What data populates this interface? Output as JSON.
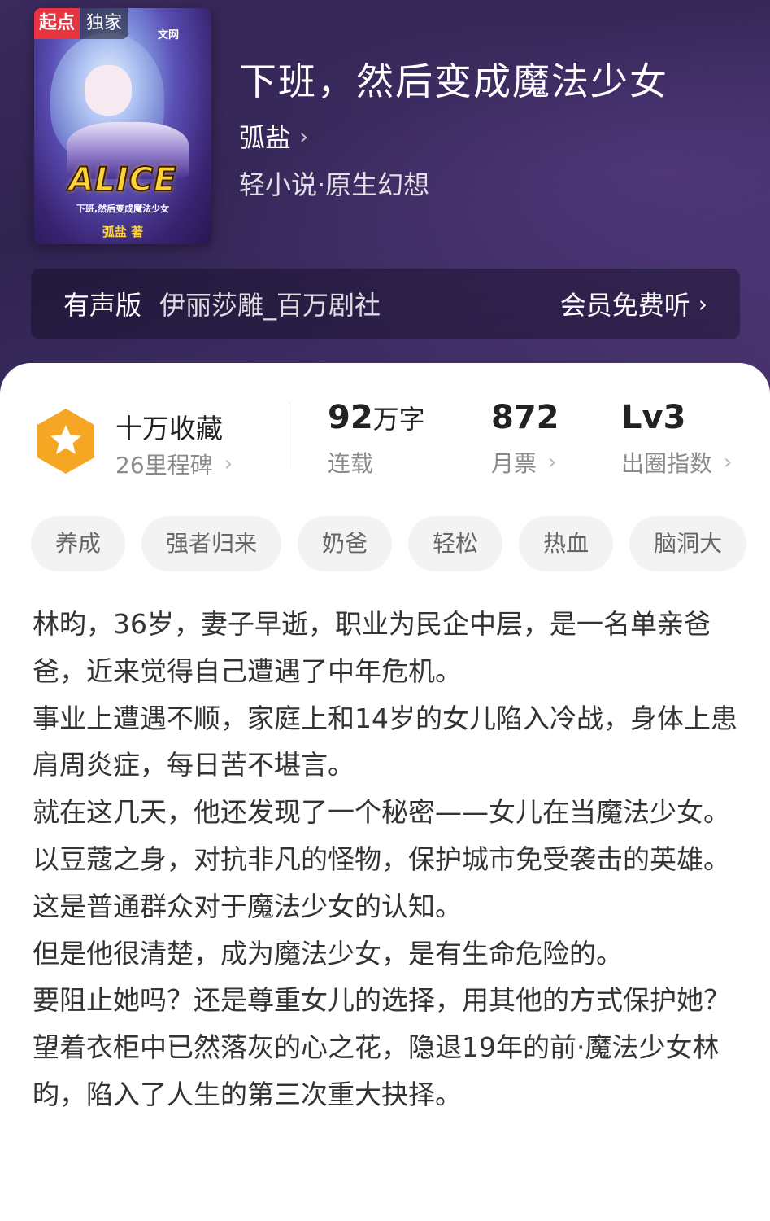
{
  "cover": {
    "badge_brand": "起点",
    "badge_exclusive": "独家",
    "site_text": "文网",
    "title_art": "ALICE",
    "subtitle_art": "下班,然后变成魔法少女",
    "author_art": "弧盐 著"
  },
  "book": {
    "title": "下班，然后变成魔法少女",
    "author": "弧盐",
    "genre": "轻小说·原生幻想"
  },
  "audio": {
    "label": "有声版",
    "narrator": "伊丽莎雕_百万剧社",
    "action": "会员免费听"
  },
  "stats": {
    "favorites": "十万收藏",
    "milestones": "26里程碑",
    "word_count_num": "92",
    "word_count_unit": "万字",
    "status": "连载",
    "monthly_tickets": "872",
    "monthly_tickets_label": "月票",
    "level": "Lv3",
    "level_label": "出圈指数"
  },
  "tags": [
    "养成",
    "强者归来",
    "奶爸",
    "轻松",
    "热血",
    "脑洞大"
  ],
  "description": [
    "林昀，36岁，妻子早逝，职业为民企中层，是一名单亲爸爸，近来觉得自己遭遇了中年危机。",
    "事业上遭遇不顺，家庭上和14岁的女儿陷入冷战，身体上患肩周炎症，每日苦不堪言。",
    "就在这几天，他还发现了一个秘密——女儿在当魔法少女。",
    "以豆蔻之身，对抗非凡的怪物，保护城市免受袭击的英雄。这是普通群众对于魔法少女的认知。",
    "但是他很清楚，成为魔法少女，是有生命危险的。",
    "要阻止她吗？还是尊重女儿的选择，用其他的方式保护她？",
    "望着衣柜中已然落灰的心之花，隐退19年的前·魔法少女林昀，陷入了人生的第三次重大抉择。"
  ],
  "colors": {
    "header_bg": "#32264f",
    "badge_red": "#e8343f",
    "star_orange": "#f5a623"
  }
}
